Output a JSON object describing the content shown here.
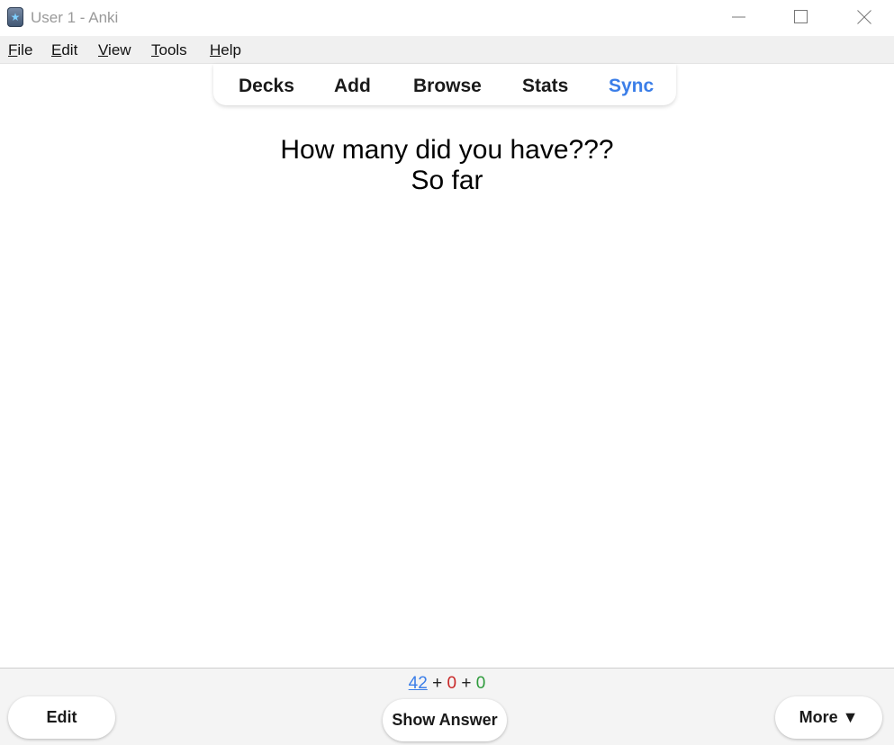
{
  "window": {
    "title": "User 1 - Anki",
    "icon": "anki-app-icon"
  },
  "window_controls": {
    "minimize": "minimize-icon",
    "maximize": "maximize-icon",
    "close": "close-icon"
  },
  "menubar": {
    "items": [
      {
        "label_underlined": "F",
        "label_rest": "ile"
      },
      {
        "label_underlined": "E",
        "label_rest": "dit"
      },
      {
        "label_underlined": "V",
        "label_rest": "iew"
      },
      {
        "label_underlined": "T",
        "label_rest": "ools"
      },
      {
        "label_underlined": "H",
        "label_rest": "elp"
      }
    ]
  },
  "toolbar": {
    "decks": "Decks",
    "add": "Add",
    "browse": "Browse",
    "stats": "Stats",
    "sync": "Sync"
  },
  "card": {
    "line1": "How many did you have???",
    "line2": "So far"
  },
  "counts": {
    "new": "42",
    "sep1": "+",
    "learn": "0",
    "sep2": "+",
    "review": "0"
  },
  "buttons": {
    "edit": "Edit",
    "show_answer": "Show Answer",
    "more": "More ▼"
  },
  "colors": {
    "sync_accent": "#3b7ee8",
    "new_count": "#3b7ee8",
    "learn_count": "#c82828",
    "review_count": "#2e9b3c"
  }
}
